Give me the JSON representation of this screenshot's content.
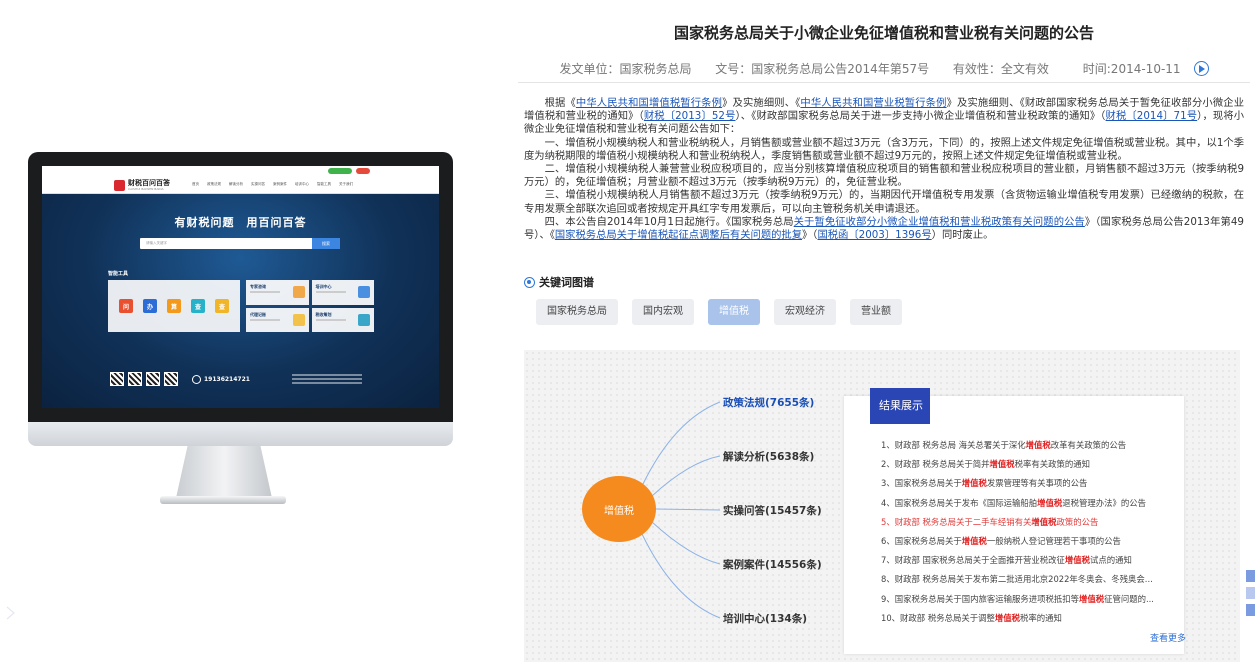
{
  "article": {
    "title": "国家税务总局关于小微企业免征增值税和营业税有关问题的公告",
    "meta": {
      "issuer": "发文单位：国家税务总局",
      "doc_number": "文号：国家税务总局公告2014年第57号",
      "validity": "有效性：全文有效",
      "date": "时间:2014-10-11"
    },
    "p1": {
      "t1": "根据《",
      "l1": "中华人民共和国增值税暂行条例",
      "t2": "》及实施细则、《",
      "l2": "中华人民共和国营业税暂行条例",
      "t3": "》及实施细则、《财政部国家税务总局关于暂免征收部分小微企业增值税和营业税的通知》（",
      "l3": "财税〔2013〕52号",
      "t4": "）、《财政部国家税务总局关于进一步支持小微企业增值税和营业税政策的通知》（",
      "l4": "财税〔2014〕71号",
      "t5": "），现将小微企业免征增值税和营业税有关问题公告如下："
    },
    "p2": "一、增值税小规模纳税人和营业税纳税人，月销售额或营业额不超过3万元（含3万元，下同）的，按照上述文件规定免征增值税或营业税。其中，以1个季度为纳税期限的增值税小规模纳税人和营业税纳税人，季度销售额或营业额不超过9万元的，按照上述文件规定免征增值税或营业税。",
    "p3": "二、增值税小规模纳税人兼营营业税应税项目的，应当分别核算增值税应税项目的销售额和营业税应税项目的营业额，月销售额不超过3万元（按季纳税9万元）的，免征增值税；月营业额不超过3万元（按季纳税9万元）的，免征营业税。",
    "p4": "三、增值税小规模纳税人月销售额不超过3万元（按季纳税9万元）的，当期因代开增值税专用发票（含货物运输业增值税专用发票）已经缴纳的税款，在专用发票全部联次追回或者按规定开具红字专用发票后，可以向主管税务机关申请退还。",
    "p5": {
      "t1": "四、本公告自2014年10月1日起施行。《国家税务总局",
      "l1": "关于暂免征收部分小微企业增值税和营业税政策有关问题的公告",
      "t2": "》（国家税务总局公告2013年第49号）、《",
      "l2": "国家税务总局关于增值税起征点调整后有关问题的批复",
      "t3": "》（",
      "l3": "国税函〔2003〕1396号",
      "t4": "）同时废止。"
    }
  },
  "keywords": {
    "heading": "关键词图谱",
    "tags": [
      "国家税务总局",
      "国内宏观",
      "增值税",
      "宏观经济",
      "营业额"
    ],
    "active_index": 2
  },
  "graph": {
    "center": "增值税",
    "branches": [
      "政策法规(7655条)",
      "解读分析(5638条)",
      "实操问答(15457条)",
      "案例案件(14556条)",
      "培训中心(134条)"
    ],
    "result_tab": "结果展示",
    "results": [
      {
        "pre": "1、财政部 税务总局 海关总署关于深化",
        "kw": "增值税",
        "post": "改革有关政策的公告",
        "highlight": false
      },
      {
        "pre": "2、财政部 税务总局关于简并",
        "kw": "增值税",
        "post": "税率有关政策的通知",
        "highlight": false
      },
      {
        "pre": "3、国家税务总局关于",
        "kw": "增值税",
        "post": "发票管理等有关事项的公告",
        "highlight": false
      },
      {
        "pre": "4、国家税务总局关于发布《国际运输船舶",
        "kw": "增值税",
        "post": "退税管理办法》的公告",
        "highlight": false
      },
      {
        "pre": "5、财政部 税务总局关于二手车经销有关",
        "kw": "增值税",
        "post": "政策的公告",
        "highlight": true
      },
      {
        "pre": "6、国家税务总局关于",
        "kw": "增值税",
        "post": "一般纳税人登记管理若干事项的公告",
        "highlight": false
      },
      {
        "pre": "7、财政部 国家税务总局关于全面推开营业税改征",
        "kw": "增值税",
        "post": "试点的通知",
        "highlight": false
      },
      {
        "pre": "8、财政部 税务总局关于发布第二批适用北京2022年冬奥会、冬残奥会...",
        "kw": "",
        "post": "",
        "highlight": false
      },
      {
        "pre": "9、国家税务总局关于国内旅客运输服务进项税抵扣等",
        "kw": "增值税",
        "post": "征管问题的...",
        "highlight": false
      },
      {
        "pre": "10、财政部 税务总局关于调整",
        "kw": "增值税",
        "post": "税率的通知",
        "highlight": false
      }
    ],
    "more": "查看更多"
  },
  "mockup": {
    "logo": "财税百问百答",
    "logo_sub": "CAISHUI BAIWEN BAIDA",
    "menu": [
      "首页",
      "政策法规",
      "解读分析",
      "实操问答",
      "案例案件",
      "培训中心",
      "智能工具",
      "关于我们"
    ],
    "slogan": "有财税问题　用百问百答",
    "search_placeholder": "请输入关键字",
    "search_button": "搜索",
    "tools_title": "智能工具",
    "tools": [
      "问",
      "办",
      "算",
      "查",
      "查"
    ],
    "cards": [
      "专家咨询",
      "培训中心",
      "代理记账",
      "税收筹划"
    ],
    "phone": "19136214721"
  },
  "colors": {
    "accent": "#2f78d8",
    "center_node": "#f58a1f",
    "result_tab": "#2a46b4",
    "keyword_red": "#e02020"
  }
}
